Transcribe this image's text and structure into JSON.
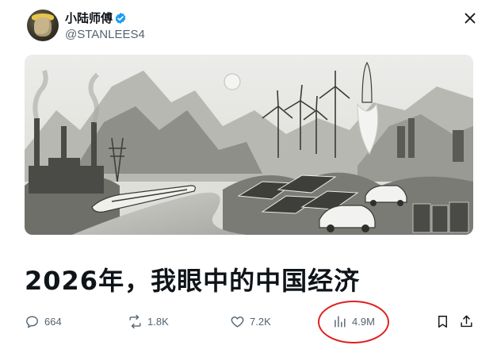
{
  "post": {
    "author": {
      "display_name": "小陆师傅",
      "handle": "@STANLEES4",
      "verified": true
    },
    "text": "2026年，我眼中的中国经济",
    "media_alt": "Ink-wash illustration of mountains, factories, a high-speed train, wind turbines, a rocket launch, solar panels and electric cars"
  },
  "actions": {
    "replies": "664",
    "reposts": "1.8K",
    "likes": "7.2K",
    "views": "4.9M"
  },
  "icons": {
    "verified": "verified-badge-icon",
    "close": "close-icon",
    "reply": "reply-icon",
    "repost": "repost-icon",
    "like": "heart-icon",
    "views": "views-chart-icon",
    "bookmark": "bookmark-icon",
    "share": "share-icon"
  },
  "colors": {
    "verified_blue": "#1d9bf0",
    "annotation_red": "#e02020",
    "muted_text": "#536471"
  }
}
